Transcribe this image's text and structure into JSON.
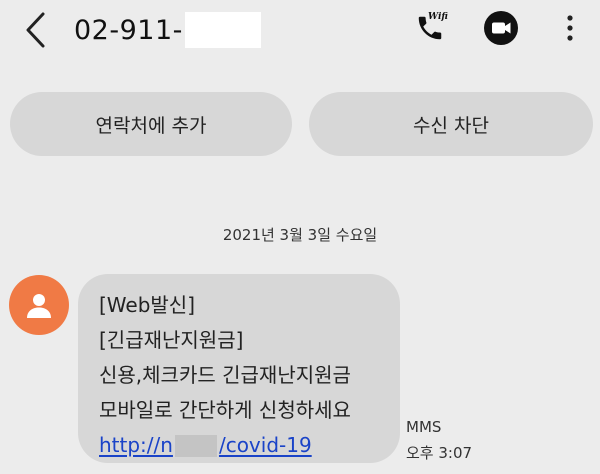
{
  "header": {
    "title": "02-911-",
    "call_badge": "Wifi"
  },
  "actions": {
    "add_contact": "연락처에 추가",
    "block": "수신 차단"
  },
  "conversation": {
    "date": "2021년 3월 3일 수요일",
    "message": {
      "lines": [
        "[Web발신]",
        "[긴급재난지원금]",
        "신용,체크카드 긴급재난지원금",
        "모바일로 간단하게 신청하세요"
      ],
      "link_prefix": "http://n",
      "link_suffix": "/covid-19",
      "type": "MMS",
      "time": "오후 3:07"
    }
  },
  "colors": {
    "background": "#ececec",
    "bubble": "#d7d7d7",
    "avatar": "#f07a45",
    "link": "#1a43c8"
  }
}
